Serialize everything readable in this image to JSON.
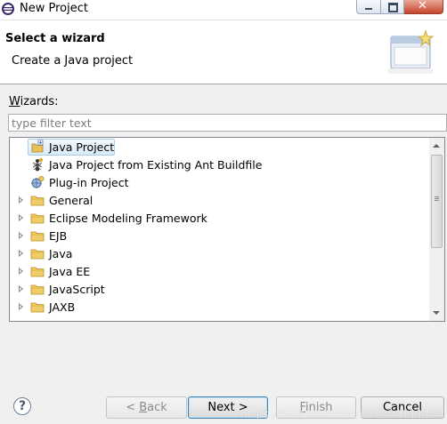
{
  "window": {
    "title": "New Project",
    "buttons": [
      "minimize",
      "maximize",
      "close"
    ]
  },
  "header": {
    "title": "Select a wizard",
    "description": "Create a Java project"
  },
  "wizards": {
    "label_prefix": "W",
    "label_rest": "izards:",
    "filter_placeholder": "type filter text",
    "filter_value": "",
    "items": [
      {
        "label": "Java Project",
        "icon": "java-project-icon",
        "expandable": false,
        "selected": true
      },
      {
        "label": "Java Project from Existing Ant Buildfile",
        "icon": "ant-icon",
        "expandable": false,
        "selected": false
      },
      {
        "label": "Plug-in Project",
        "icon": "plugin-icon",
        "expandable": false,
        "selected": false
      },
      {
        "label": "General",
        "icon": "folder-icon",
        "expandable": true,
        "selected": false
      },
      {
        "label": "Eclipse Modeling Framework",
        "icon": "folder-icon",
        "expandable": true,
        "selected": false
      },
      {
        "label": "EJB",
        "icon": "folder-icon",
        "expandable": true,
        "selected": false
      },
      {
        "label": "Java",
        "icon": "folder-icon",
        "expandable": true,
        "selected": false
      },
      {
        "label": "Java EE",
        "icon": "folder-icon",
        "expandable": true,
        "selected": false
      },
      {
        "label": "JavaScript",
        "icon": "folder-icon",
        "expandable": true,
        "selected": false
      },
      {
        "label": "JAXB",
        "icon": "folder-icon",
        "expandable": true,
        "selected": false
      }
    ]
  },
  "buttons": {
    "help": "?",
    "back_pre": "< ",
    "back_u": "B",
    "back_rest": "ack",
    "next": "Next >",
    "finish_u": "F",
    "finish_rest": "inish",
    "cancel": "Cancel"
  },
  "watermark": "https://blog.csdn.net/u013391111",
  "colors": {
    "selection": "#d9ebf9",
    "folder": "#e8c15a",
    "default_button_border": "#3c7fb1"
  }
}
